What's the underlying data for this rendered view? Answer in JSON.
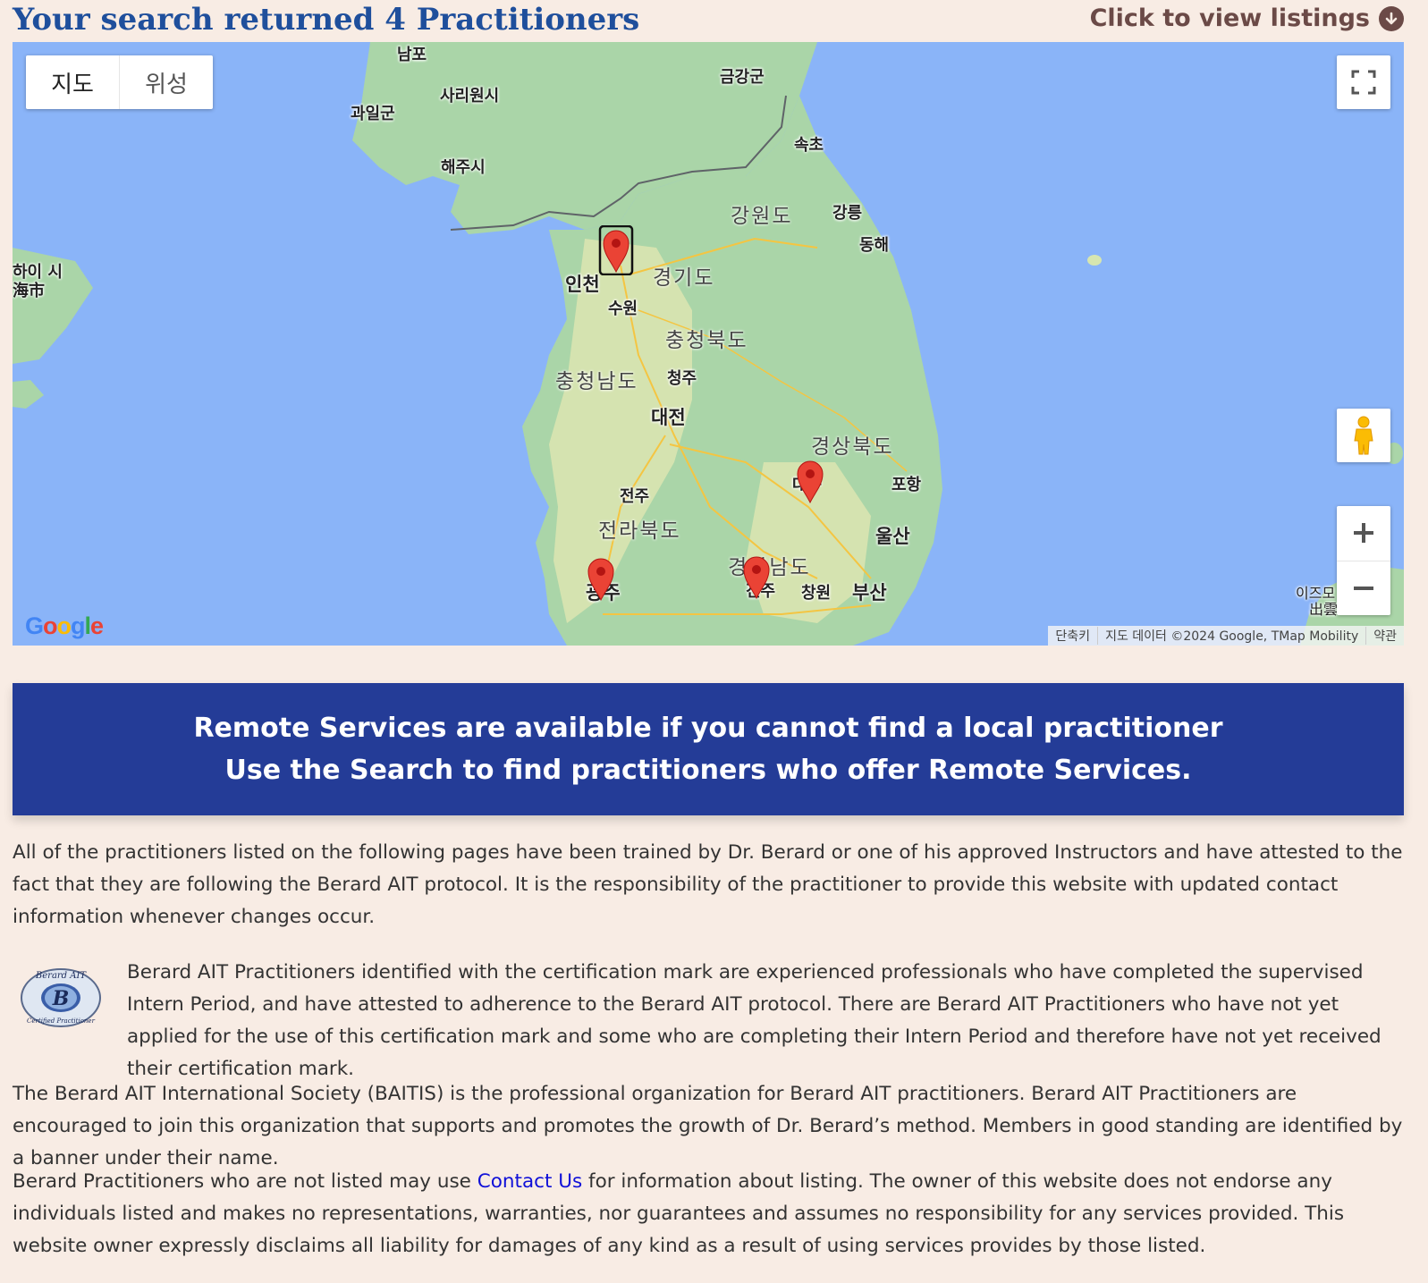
{
  "header": {
    "title": "Your search returned 4 Practitioners",
    "listings_link": "Click to view listings",
    "listings_icon": "arrow-down-circle-icon"
  },
  "map": {
    "type_buttons": [
      "지도",
      "위성"
    ],
    "provinces": [
      "강원도",
      "경기도",
      "충청북도",
      "충청남도",
      "경상북도",
      "전라북도",
      "경상남도"
    ],
    "cities": [
      "남포",
      "사리원시",
      "과일군",
      "해주시",
      "금강군",
      "속초",
      "강릉",
      "동해",
      "인천",
      "수원",
      "청주",
      "대전",
      "전주",
      "포항",
      "울산",
      "창원",
      "부산",
      "광주",
      "진주",
      "대구",
      "하이 시",
      "海市",
      "이즈모",
      "出雲"
    ],
    "attribution": [
      "단축키",
      "지도 데이터 ©2024 Google, TMap Mobility",
      "약관"
    ],
    "logo": "Google",
    "marker_count": 4
  },
  "remote_banner": {
    "line1": "Remote Services are available if you cannot find a local practitioner",
    "line2": "Use the Search to find practitioners who offer Remote Services."
  },
  "paragraphs": {
    "p1": "All of the practitioners listed on the following pages have been trained by Dr. Berard or one of his approved Instructors and have attested to the fact that they are following the Berard AIT protocol. It is the responsibility of the practitioner to provide this website with updated contact information whenever changes occur.",
    "p2": "Berard AIT Practitioners identified with the certification mark are experienced professionals who have completed the supervised Intern Period, and have attested to adherence to the Berard AIT protocol. There are Berard AIT Practitioners who have not yet applied for the use of this certification mark and some who are completing their Intern Period and therefore have not yet received their certification mark.",
    "p3": "The Berard AIT International Society (BAITIS) is the professional organization for Berard AIT practitioners. Berard AIT Practitioners are encouraged to join this organization that supports and promotes the growth of Dr. Berard’s method. Members in good standing are identified by a banner under their name.",
    "p4_before": "Berard Practitioners who are not listed may use ",
    "p4_link": "Contact Us",
    "p4_after": " for information about listing. The owner of this website does not endorse any individuals listed and makes no representations, warranties, nor guarantees and assumes no responsibility for any services provided. This website owner expressly disclaims all liability for damages of any kind as a result of using services provides by those listed."
  },
  "cert_logo": {
    "top_text": "Berard AIT",
    "letter": "B",
    "bottom_text": "Certified Practitioner"
  },
  "colors": {
    "background": "#f8ece4",
    "title": "#1f4f9c",
    "banner": "#243c97",
    "link": "#1010d8",
    "marker": "#ea4335"
  }
}
